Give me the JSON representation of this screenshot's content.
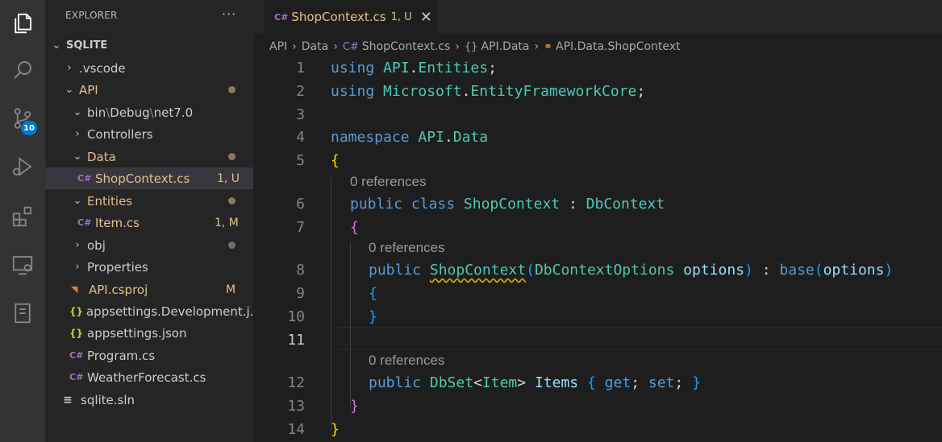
{
  "explorer": {
    "title": "EXPLORER",
    "more": "···",
    "root": "SQLITE",
    "items": [
      {
        "label": ".vscode"
      },
      {
        "label": "API"
      },
      {
        "label_parts": [
          "bin",
          "Debug",
          "net7.0"
        ],
        "sep": "\\"
      },
      {
        "label": "Controllers"
      },
      {
        "label": "Data"
      },
      {
        "label": "ShopContext.cs",
        "status": "1, U"
      },
      {
        "label": "Entities"
      },
      {
        "label": "Item.cs",
        "status": "1, M"
      },
      {
        "label": "obj"
      },
      {
        "label": "Properties"
      },
      {
        "label": "API.csproj",
        "status": "M"
      },
      {
        "label": "appsettings.Development.j..."
      },
      {
        "label": "appsettings.json"
      },
      {
        "label": "Program.cs"
      },
      {
        "label": "WeatherForecast.cs"
      },
      {
        "label": "sqlite.sln"
      }
    ]
  },
  "activity": {
    "source_control_badge": "10",
    "icons": [
      "files-icon",
      "search-icon",
      "source-control-icon",
      "run-debug-icon",
      "extensions-icon",
      "remote-explorer-icon",
      "notebook-icon"
    ]
  },
  "tab": {
    "icon": "C#",
    "label": "ShopContext.cs",
    "status": "1, U",
    "close": "✕"
  },
  "breadcrumbs": {
    "parts": [
      "API",
      "Data",
      "ShopContext.cs",
      "API.Data",
      "API.Data.ShopContext"
    ],
    "sep": "›"
  },
  "code": {
    "line_numbers": [
      "1",
      "2",
      "3",
      "4",
      "5",
      "6",
      "7",
      "8",
      "9",
      "10",
      "11",
      "12",
      "13",
      "14"
    ],
    "codelens": "0 references",
    "lines": {
      "l1": [
        "using",
        " ",
        "API",
        ".",
        "Entities",
        ";"
      ],
      "l2": [
        "using",
        " ",
        "Microsoft",
        ".",
        "EntityFrameworkCore",
        ";"
      ],
      "l4": [
        "namespace",
        " ",
        "API",
        ".",
        "Data"
      ],
      "l5": "{",
      "l6": [
        "public",
        " ",
        "class",
        " ",
        "ShopContext",
        " : ",
        "DbContext"
      ],
      "l7": "{",
      "l8": [
        "public",
        " ",
        "ShopContext",
        "(",
        "DbContextOptions",
        " ",
        "options",
        ")",
        " : ",
        "base",
        "(",
        "options",
        ")"
      ],
      "l9": "{",
      "l10": "}",
      "l12": [
        "public",
        " ",
        "DbSet",
        "<",
        "Item",
        ">",
        " ",
        "Items",
        " ",
        "{",
        " ",
        "get",
        "; ",
        "set",
        "; ",
        "}"
      ],
      "l13": "}",
      "l14": "}"
    }
  },
  "colors": {
    "accent": "#007acc",
    "modified": "#e2c08d",
    "keyword": "#569cd6",
    "type": "#4ec9b0"
  }
}
